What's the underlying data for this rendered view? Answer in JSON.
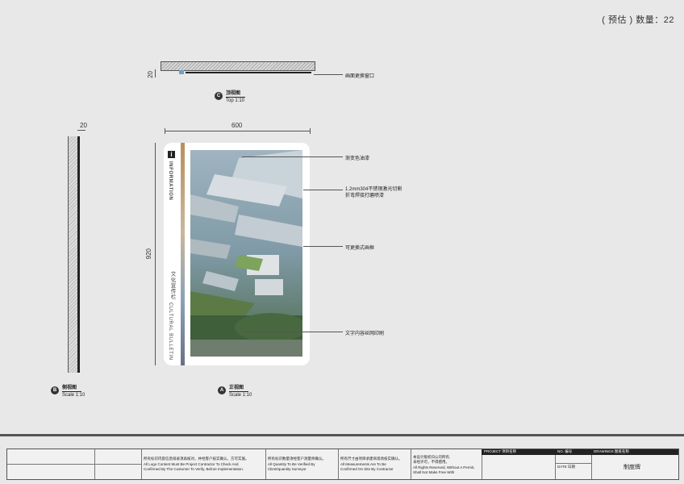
{
  "quantity_label": "( 预估 ) 数量：22",
  "top_view": {
    "dim_depth": "20",
    "callout": "画面更换窗口",
    "title_letter": "C",
    "title": "顶视图",
    "scale": "Top 1:10"
  },
  "side_view": {
    "dim_depth": "20",
    "title_letter": "B",
    "title": "侧视图",
    "scale": "Scale 1:10"
  },
  "front_view": {
    "dim_width": "600",
    "dim_height": "920",
    "title_letter": "A",
    "title": "正视图",
    "scale": "Scale 1:10",
    "info_icon": "i",
    "info_text": "INFORMATION",
    "bulletin_cn": "文化宣传栏",
    "bulletin_en": "CULTURAL BULLETIN",
    "callouts": [
      "渐变色油漆",
      "1.2mm304不锈钢激光切割",
      "折弯焊接打磨喷漆",
      "可更换式画框",
      "文字内容丝网印刷"
    ]
  },
  "title_block": {
    "note1_cn": "所有标识内容信息排录须再核对，并经客户核实确认，方可实施。",
    "note1_en": [
      "All Logo Content Must Be Project Contractor To Check And",
      "Confirmed By The Customer To Verify, Before Implementation."
    ],
    "note2_cn": "所有标识数量须经客户测量师确认。",
    "note2_en": [
      "All Quantity To Be Verified By",
      "Client/quantity Surveyor"
    ],
    "note3_cn": "所有尺寸由项目承建商现场核实确认。",
    "note3_en": [
      "All Measurements Are To Be",
      "Confirmed On Site By Contractor"
    ],
    "note4_cn": [
      "本设计版权归公司所有,",
      "未经许可，不得擅用。"
    ],
    "note4_en": [
      "All Rights Reserved, Without A Permit,",
      "Shall Not Make Free With"
    ],
    "project_label": "PROJECT 项目名称",
    "no_label": "NO. 编号",
    "date_label": "DATE 日期",
    "drawings_label": "DRAWINGS 图纸名称",
    "drawing_name": "制度牌"
  },
  "colors": {
    "background": "#e8e8e8",
    "sign_face": "#ffffff",
    "line": "#555555",
    "dark_band": "#222222"
  }
}
